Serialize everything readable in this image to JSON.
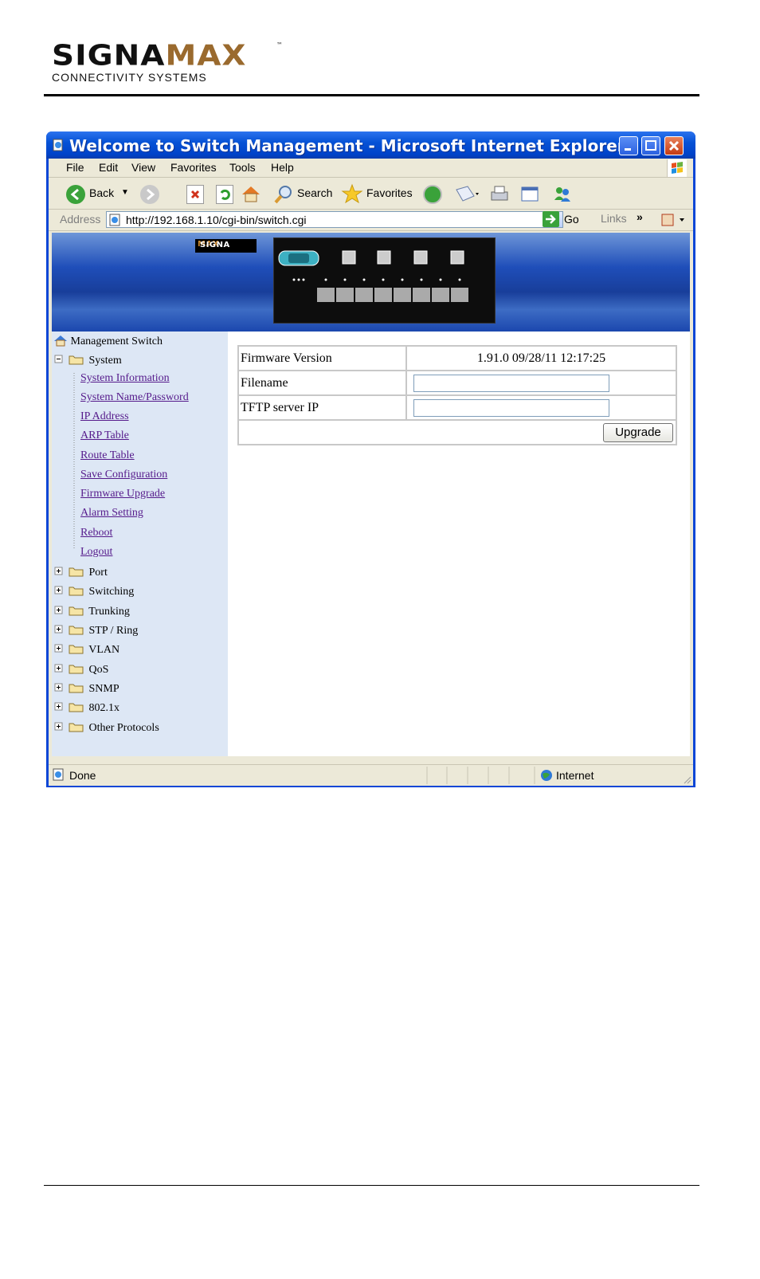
{
  "doc_header": {
    "logo_main": "SIGNA",
    "logo_accent": "MAX",
    "logo_tm": "™",
    "logo_sub": "CONNECTIVITY SYSTEMS"
  },
  "window": {
    "title": "Welcome to Switch Management - Microsoft Internet Explorer"
  },
  "menu": {
    "file": "File",
    "edit": "Edit",
    "view": "View",
    "favorites": "Favorites",
    "tools": "Tools",
    "help": "Help"
  },
  "toolbar": {
    "back": "Back",
    "search": "Search",
    "favorites": "Favorites"
  },
  "address": {
    "label": "Address",
    "url": "http://192.168.1.10/cgi-bin/switch.cgi",
    "go": "Go",
    "links": "Links",
    "chevron": "»"
  },
  "banner": {
    "logo_main": "SIGNA",
    "logo_accent": "MAX"
  },
  "sidebar": {
    "root": "Management Switch",
    "system": "System",
    "system_items": [
      "System Information",
      "System Name/Password",
      "IP Address",
      "ARP Table",
      "Route Table",
      "Save Configuration",
      "Firmware Upgrade",
      "Alarm Setting",
      "Reboot",
      "Logout"
    ],
    "folders": [
      "Port",
      "Switching",
      "Trunking",
      "STP / Ring",
      "VLAN",
      "QoS",
      "SNMP",
      "802.1x",
      "Other Protocols"
    ]
  },
  "firmware": {
    "version_label": "Firmware Version",
    "version_value": "1.91.0 09/28/11 12:17:25",
    "filename_label": "Filename",
    "filename_value": "",
    "tftp_label": "TFTP server IP",
    "tftp_value": "",
    "upgrade_button": "Upgrade"
  },
  "status": {
    "left": "Done",
    "zone": "Internet"
  }
}
